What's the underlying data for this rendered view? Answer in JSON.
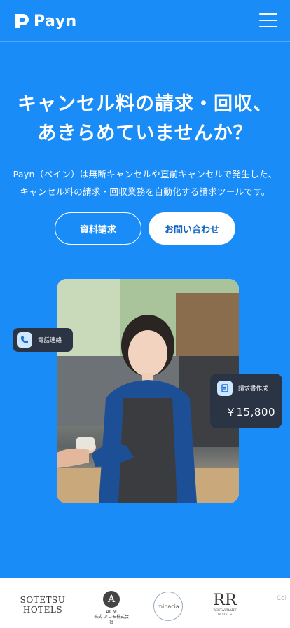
{
  "header": {
    "brand": "Payn",
    "menu_icon": "hamburger-menu-icon"
  },
  "hero": {
    "title_line1": "キャンセル料の請求・回収、",
    "title_line2": "あきらめていませんか？",
    "desc_line1": "Payn（ペイン）は無断キャンセルや直前キャンセルで発生した、",
    "desc_line2": "キャンセル料の請求・回収業務を自動化する請求ツールです。",
    "cta_document": "資料請求",
    "cta_contact": "お問い合わせ"
  },
  "badges": {
    "call_label": "電話連絡",
    "call_icon": "phone-icon",
    "invoice_label": "請求書作成",
    "invoice_icon": "document-icon",
    "invoice_amount": "￥15,800"
  },
  "clients": {
    "sotetsu_line1": "SOTETSU",
    "sotetsu_line2": "HOTELS",
    "acm_mark": "A",
    "acm_name": "ACM",
    "acm_sub": "株式 アコモ株式会社",
    "minacia": "minacia",
    "rr_mark": "RR",
    "rr_sub": "RESTAURANT HOTELS",
    "partial": "Coi"
  },
  "colors": {
    "background": "#1a8cf7",
    "badge_bg": "#2b3445",
    "primary_text_on_white": "#1565c0"
  }
}
